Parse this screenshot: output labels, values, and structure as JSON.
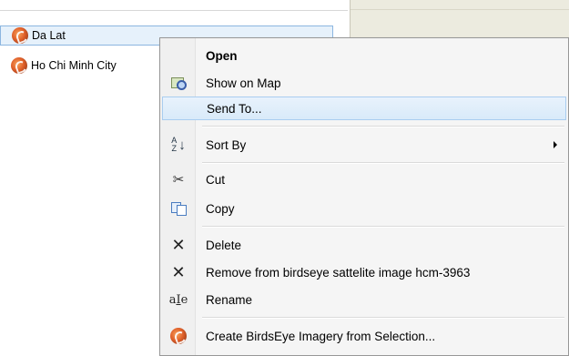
{
  "list": {
    "items": [
      {
        "label": "Da Lat",
        "icon": "birdseye-logo-icon",
        "selected": true
      },
      {
        "label": "Ho Chi Minh City",
        "icon": "birdseye-logo-icon",
        "selected": false
      }
    ]
  },
  "context_menu": {
    "items": [
      {
        "id": "open",
        "label": "Open",
        "icon": "",
        "bold": true
      },
      {
        "id": "show-on-map",
        "label": "Show on Map",
        "icon": "map-magnifier-icon"
      },
      {
        "id": "send-to",
        "label": "Send To...",
        "icon": "",
        "highlighted": true
      },
      {
        "id": "sort-by",
        "label": "Sort By",
        "icon": "sort-az-icon",
        "submenu": true
      },
      {
        "id": "cut",
        "label": "Cut",
        "icon": "scissors-icon"
      },
      {
        "id": "copy",
        "label": "Copy",
        "icon": "copy-icon"
      },
      {
        "id": "delete",
        "label": "Delete",
        "icon": "x-icon"
      },
      {
        "id": "remove",
        "label": "Remove from birdseye sattelite image hcm-3963",
        "icon": "x-icon"
      },
      {
        "id": "rename",
        "label": "Rename",
        "icon": "rename-icon"
      },
      {
        "id": "create-birdseye",
        "label": "Create BirdsEye Imagery from Selection...",
        "icon": "birdseye-logo-icon"
      }
    ],
    "sort_icon_text": "A\nZ"
  },
  "colors": {
    "highlight": "#d9eaf9",
    "highlight_border": "#a9cdf0",
    "map_panel": "#ecebdf",
    "menu_bg": "#f5f5f5"
  }
}
